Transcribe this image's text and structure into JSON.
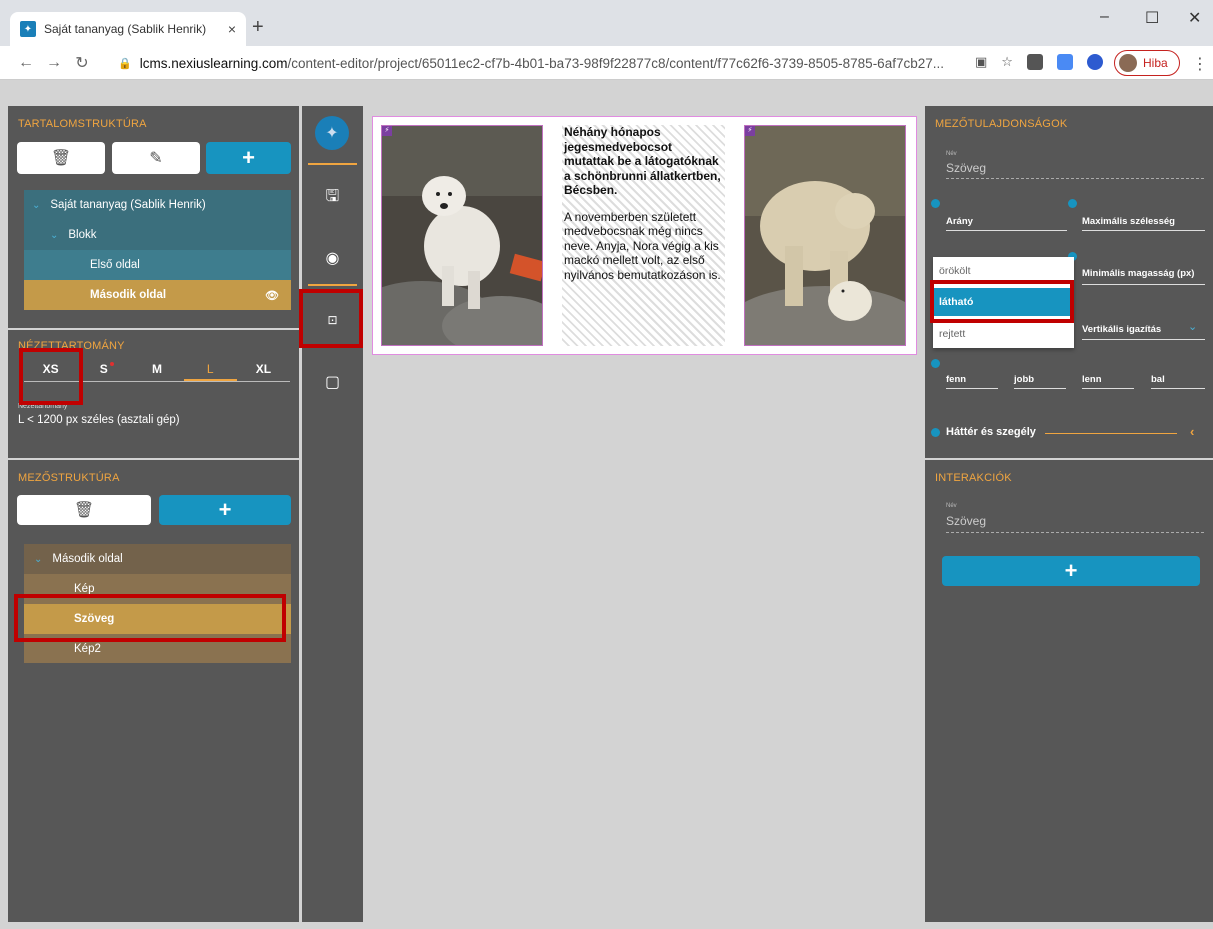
{
  "browser": {
    "tab_title": "Saját tananyag (Sablik Henrik)",
    "tab_close": "×",
    "new_tab": "+",
    "url_host": "lcms.nexiuslearning.com",
    "url_path": "/content-editor/project/65011ec2-cf7b-4b01-ba73-98f9f22877c8/content/f77c62f6-3739-8505-8785-6af7cb27...",
    "profile_label": "Hiba",
    "window_controls": [
      "–",
      "☐",
      "✕"
    ]
  },
  "content_structure": {
    "title": "TARTALOMSTRUKTÚRA",
    "tree": [
      {
        "label": "Saját tananyag (Sablik Henrik)",
        "expanded": true
      },
      {
        "label": "Blokk",
        "expanded": true
      },
      {
        "label": "Első oldal"
      },
      {
        "label": "Második oldal",
        "selected": true
      }
    ]
  },
  "viewport": {
    "title": "NÉZETTARTOMÁNY",
    "tabs": [
      "XS",
      "S",
      "M",
      "L",
      "XL"
    ],
    "active_tab": "L",
    "small_label": "Nézettartomány",
    "description": "L < 1200 px széles (asztali gép)"
  },
  "field_structure": {
    "title": "MEZŐSTRUKTÚRA",
    "tree": [
      {
        "label": "Második oldal",
        "expanded": true
      },
      {
        "label": "Kép"
      },
      {
        "label": "Szöveg",
        "selected": true
      },
      {
        "label": "Kép2"
      }
    ]
  },
  "canvas": {
    "heading": "Néhány hónapos jegesmedvebocsot mutattak be a látogatóknak a schönbrunni állatkertben, Bécsben.",
    "body": "A novemberben született medvebocsnak még nincs neve. Anyja, Nora végig a kis mackó mellett volt, az első nyilvános bemutatkozáson is."
  },
  "field_properties": {
    "title": "MEZŐTULAJDONSÁGOK",
    "name_label": "Név",
    "name_value": "Szöveg",
    "ratio_label": "Arány",
    "max_width_label": "Maximális szélesség",
    "min_height_label": "Minimális magasság (px)",
    "vertical_align_label": "Vertikális igazítás",
    "padding_labels": [
      "fenn",
      "jobb",
      "lenn",
      "bal"
    ],
    "background_border_label": "Háttér és szegély",
    "visibility_options": [
      "örökölt",
      "látható",
      "rejtett"
    ],
    "visibility_selected": "látható"
  },
  "interactions": {
    "title": "INTERAKCIÓK",
    "name_label": "Név",
    "name_value": "Szöveg"
  },
  "colors": {
    "panel": "#575757",
    "accent_orange": "#f0a540",
    "accent_blue": "#1794c0",
    "selected_gold": "#c49a49",
    "tree_teal": "#3e7d8e",
    "highlight_red": "#c00000"
  }
}
